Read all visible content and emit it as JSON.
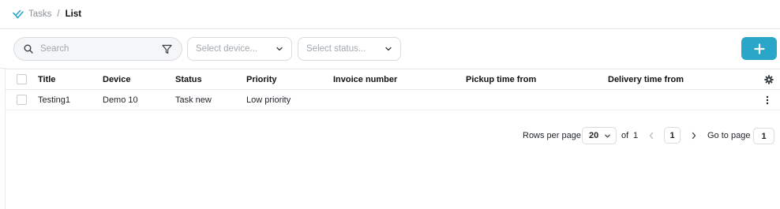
{
  "breadcrumb": {
    "root": "Tasks",
    "separator": "/",
    "current": "List",
    "icon": "double-check-icon"
  },
  "toolbar": {
    "search_placeholder": "Search",
    "device_placeholder": "Select device...",
    "status_placeholder": "Select status...",
    "add_button_icon": "plus-icon",
    "accent_color": "#2aa6c8"
  },
  "table": {
    "columns": [
      "Title",
      "Device",
      "Status",
      "Priority",
      "Invoice number",
      "Pickup time from",
      "Delivery time from"
    ],
    "rows": [
      {
        "title": "Testing1",
        "device": "Demo 10",
        "status": "Task new",
        "priority": "Low priority",
        "invoice_number": "",
        "pickup_time_from": "",
        "delivery_time_from": ""
      }
    ]
  },
  "pagination": {
    "rows_per_page_label": "Rows per page",
    "rows_per_page_value": "20",
    "of_label": "of",
    "total_pages": "1",
    "current_page": "1",
    "go_to_page_label": "Go to page",
    "go_to_page_value": "1"
  }
}
